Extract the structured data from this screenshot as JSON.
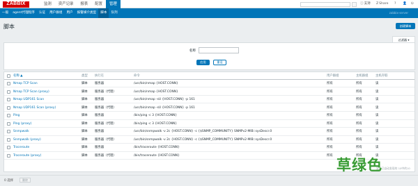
{
  "header": {
    "logo": "ZABBIX",
    "menu": [
      "监测",
      "资产记录",
      "报表",
      "配置",
      "管理"
    ],
    "active_menu": "管理",
    "right_icons": [
      {
        "name": "support-icon",
        "glyph": "ⓘ",
        "label": "支持"
      },
      {
        "name": "share-icon",
        "glyph": "Z",
        "label": "Share"
      },
      {
        "name": "help-icon",
        "glyph": "?",
        "label": ""
      },
      {
        "name": "user-icon",
        "glyph": "👤",
        "label": ""
      },
      {
        "name": "logout-icon",
        "glyph": "⏻",
        "label": ""
      }
    ]
  },
  "submenu": {
    "items": [
      "一般",
      "agent代理程序",
      "认证",
      "用户群组",
      "用户",
      "报警媒介类型",
      "脚本",
      "队列"
    ],
    "active": "脚本",
    "right_text": "zabbix-server"
  },
  "page": {
    "title": "脚本",
    "create_button": "创建脚本",
    "filter_tab": "过滤器"
  },
  "filter": {
    "name_label": "名称",
    "name_value": "",
    "apply": "应用",
    "reset": "重设"
  },
  "table": {
    "columns": [
      "名称 ▲",
      "类型",
      "执行在",
      "命令",
      "用户群组",
      "主机群组",
      "主机存取"
    ],
    "rows": [
      {
        "name": "Nmap TCP Scan",
        "type": "脚本",
        "exec": "服务器",
        "command": "/usr/bin/nmap {HOST.CONN}",
        "usergroup": "所有",
        "hostgroup": "所有",
        "access": "读"
      },
      {
        "name": "Nmap TCP Scan (proxy)",
        "type": "脚本",
        "exec": "服务器（代理）",
        "command": "/usr/bin/nmap {HOST.CONN}",
        "usergroup": "所有",
        "hostgroup": "所有",
        "access": "读"
      },
      {
        "name": "Nmap UDP161 Scan",
        "type": "脚本",
        "exec": "服务器",
        "command": "/usr/bin/nmap -sU {HOST.CONN} -p 161",
        "usergroup": "所有",
        "hostgroup": "所有",
        "access": "读"
      },
      {
        "name": "Nmap UDP161 Scan (proxy)",
        "type": "脚本",
        "exec": "服务器（代理）",
        "command": "/usr/bin/nmap -sU {HOST.CONN} -p 161",
        "usergroup": "所有",
        "hostgroup": "所有",
        "access": "读"
      },
      {
        "name": "Ping",
        "type": "脚本",
        "exec": "服务器",
        "command": "/bin/ping -c 3 {HOST.CONN}",
        "usergroup": "所有",
        "hostgroup": "所有",
        "access": "读"
      },
      {
        "name": "Ping (proxy)",
        "type": "脚本",
        "exec": "服务器（代理）",
        "command": "/bin/ping -c 3 {HOST.CONN}",
        "usergroup": "所有",
        "hostgroup": "所有",
        "access": "读"
      },
      {
        "name": "Snmpwalk",
        "type": "脚本",
        "exec": "服务器",
        "command": "/usr/bin/snmpwalk -v 2c {HOST.CONN} -c {$SNMP_COMMUNITY} SNMPv2-MIB::sysDescr.0",
        "usergroup": "所有",
        "hostgroup": "所有",
        "access": "读"
      },
      {
        "name": "Snmpwalk (proxy)",
        "type": "脚本",
        "exec": "服务器（代理）",
        "command": "/usr/bin/snmpwalk -v 2c {HOST.CONN} -c {$SNMP_COMMUNITY} SNMPv2-MIB::sysDescr.0",
        "usergroup": "所有",
        "hostgroup": "所有",
        "access": "读"
      },
      {
        "name": "Traceroute",
        "type": "脚本",
        "exec": "服务器",
        "command": "/bin/traceroute {HOST.CONN}",
        "usergroup": "所有",
        "hostgroup": "所有",
        "access": "读"
      },
      {
        "name": "Traceroute (proxy)",
        "type": "脚本",
        "exec": "服务器（代理）",
        "command": "/bin/traceroute {HOST.CONN}",
        "usergroup": "所有",
        "hostgroup": "所有",
        "access": "读"
      }
    ],
    "found_text": "显示已自动发现的 10中的10"
  },
  "footer": {
    "selected": "0 选择",
    "delete": "删除"
  },
  "watermark": "草绿色"
}
